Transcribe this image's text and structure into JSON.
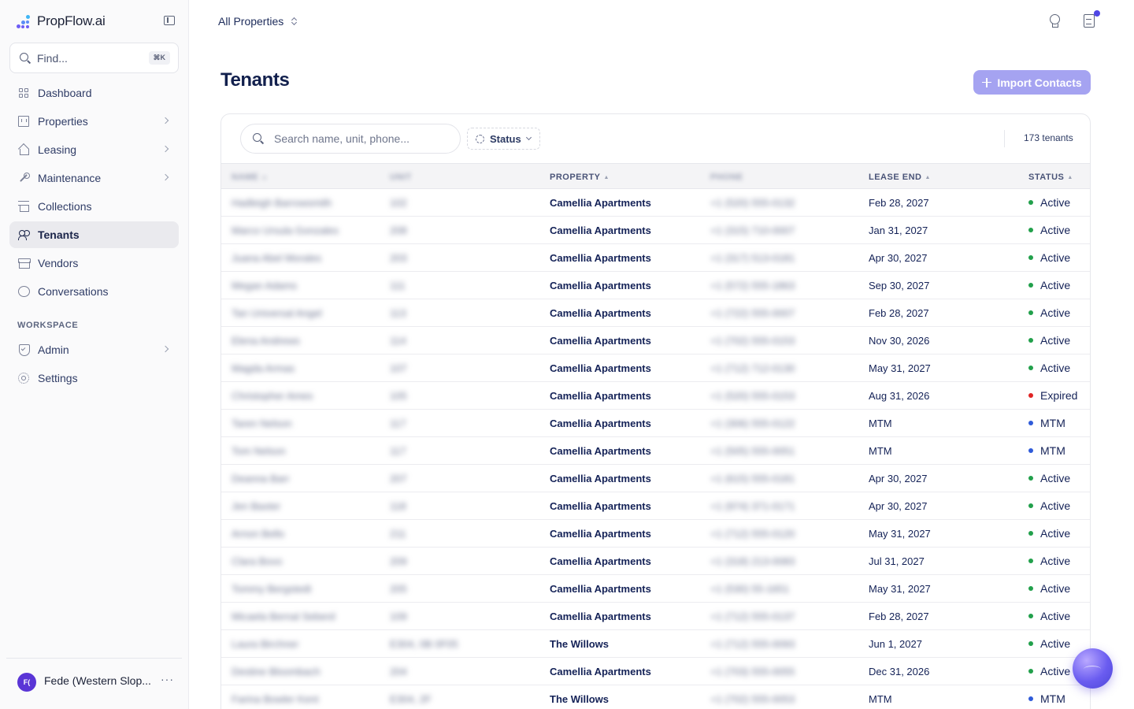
{
  "brand": {
    "name": "PropFlow.ai"
  },
  "find": {
    "placeholder": "Find...",
    "shortcut": "⌘K"
  },
  "nav": {
    "items": [
      {
        "label": "Dashboard",
        "icon": "dashboard-icon"
      },
      {
        "label": "Properties",
        "icon": "building-icon"
      },
      {
        "label": "Leasing",
        "icon": "house-icon"
      },
      {
        "label": "Maintenance",
        "icon": "wrench-icon"
      },
      {
        "label": "Collections",
        "icon": "bank-icon"
      },
      {
        "label": "Tenants",
        "icon": "users-icon",
        "active": true
      },
      {
        "label": "Vendors",
        "icon": "store-icon"
      },
      {
        "label": "Conversations",
        "icon": "chat-icon"
      }
    ],
    "workspace_label": "WORKSPACE",
    "workspace_items": [
      {
        "label": "Admin",
        "icon": "shield-icon"
      },
      {
        "label": "Settings",
        "icon": "gear-icon"
      }
    ]
  },
  "user": {
    "initials": "F(",
    "name": "Fede (Western Slop...",
    "more": "···"
  },
  "topbar": {
    "property_switch": "All Properties"
  },
  "page": {
    "title": "Tenants",
    "import_label": "Import Contacts"
  },
  "toolbar": {
    "search_placeholder": "Search name, unit, phone...",
    "status_filter": "Status",
    "count": "173 tenants"
  },
  "colors": {
    "active": "#22a04b",
    "expired": "#e02424",
    "mtm": "#2f5bd9",
    "accent": "#a5a3f1"
  },
  "table": {
    "columns": [
      "NAME",
      "UNIT",
      "PROPERTY",
      "PHONE",
      "LEASE END",
      "STATUS"
    ],
    "rows": [
      {
        "name": "Hadleigh Barrowsmith",
        "unit": "102",
        "property": "Camellia Apartments",
        "phone": "+1 (520) 555-0132",
        "lease_end": "Feb 28, 2027",
        "status": "Active"
      },
      {
        "name": "Marco Ursula Gonzales",
        "unit": "208",
        "property": "Camellia Apartments",
        "phone": "+1 (315) 710-0007",
        "lease_end": "Jan 31, 2027",
        "status": "Active"
      },
      {
        "name": "Juana Abel Morales",
        "unit": "203",
        "property": "Camellia Apartments",
        "phone": "+1 (317) 513-0181",
        "lease_end": "Apr 30, 2027",
        "status": "Active"
      },
      {
        "name": "Megan Adams",
        "unit": "111",
        "property": "Camellia Apartments",
        "phone": "+1 (572) 555-1863",
        "lease_end": "Sep 30, 2027",
        "status": "Active"
      },
      {
        "name": "Tan Universal Angel",
        "unit": "113",
        "property": "Camellia Apartments",
        "phone": "+1 (722) 555-0007",
        "lease_end": "Feb 28, 2027",
        "status": "Active"
      },
      {
        "name": "Elena Andrews",
        "unit": "114",
        "property": "Camellia Apartments",
        "phone": "+1 (702) 555-0153",
        "lease_end": "Nov 30, 2026",
        "status": "Active"
      },
      {
        "name": "Magda Armas",
        "unit": "107",
        "property": "Camellia Apartments",
        "phone": "+1 (712) 712-0130",
        "lease_end": "May 31, 2027",
        "status": "Active"
      },
      {
        "name": "Christopher Ames",
        "unit": "105",
        "property": "Camellia Apartments",
        "phone": "+1 (520) 555-0153",
        "lease_end": "Aug 31, 2026",
        "status": "Expired"
      },
      {
        "name": "Taren Nelson",
        "unit": "117",
        "property": "Camellia Apartments",
        "phone": "+1 (306) 555-0122",
        "lease_end": "MTM",
        "status": "MTM"
      },
      {
        "name": "Tom Nelson",
        "unit": "117",
        "property": "Camellia Apartments",
        "phone": "+1 (505) 555-0051",
        "lease_end": "MTM",
        "status": "MTM"
      },
      {
        "name": "Deanna Barr",
        "unit": "207",
        "property": "Camellia Apartments",
        "phone": "+1 (615) 555-0181",
        "lease_end": "Apr 30, 2027",
        "status": "Active"
      },
      {
        "name": "Jen Baxter",
        "unit": "118",
        "property": "Camellia Apartments",
        "phone": "+1 (974) 371-0171",
        "lease_end": "Apr 30, 2027",
        "status": "Active"
      },
      {
        "name": "Arnon Bello",
        "unit": "211",
        "property": "Camellia Apartments",
        "phone": "+1 (712) 555-0120",
        "lease_end": "May 31, 2027",
        "status": "Active"
      },
      {
        "name": "Clara Bovo",
        "unit": "209",
        "property": "Camellia Apartments",
        "phone": "+1 (318) 213-0083",
        "lease_end": "Jul 31, 2027",
        "status": "Active"
      },
      {
        "name": "Tommy Bergstedt",
        "unit": "205",
        "property": "Camellia Apartments",
        "phone": "+1 (530) 55-1651",
        "lease_end": "May 31, 2027",
        "status": "Active"
      },
      {
        "name": "Micaela Bernal Seberd",
        "unit": "109",
        "property": "Camellia Apartments",
        "phone": "+1 (712) 555-0137",
        "lease_end": "Feb 28, 2027",
        "status": "Active"
      },
      {
        "name": "Laura Birchner",
        "unit": "E304, 0B 0F05",
        "property": "The Willows",
        "phone": "+1 (712) 555-0093",
        "lease_end": "Jun 1, 2027",
        "status": "Active"
      },
      {
        "name": "Destine Bloombach",
        "unit": "204",
        "property": "Camellia Apartments",
        "phone": "+1 (703) 555-0055",
        "lease_end": "Dec 31, 2026",
        "status": "Active"
      },
      {
        "name": "Farina Bowler Kent",
        "unit": "E304, 2F",
        "property": "The Willows",
        "phone": "+1 (702) 555-0053",
        "lease_end": "MTM",
        "status": "MTM"
      }
    ]
  }
}
